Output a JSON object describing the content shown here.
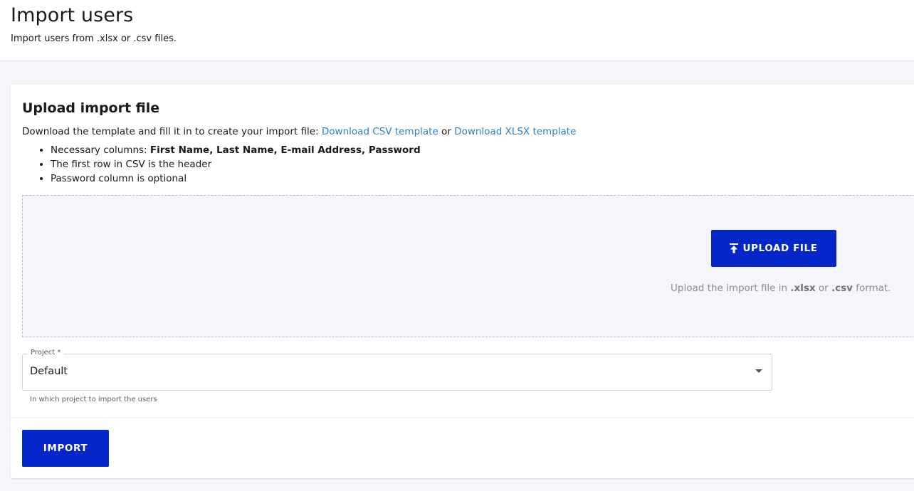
{
  "header": {
    "title": "Import users",
    "subtitle": "Import users from .xlsx or .csv files."
  },
  "card": {
    "title": "Upload import file",
    "description": "Download the template and fill it in to create your import file: ",
    "csv_link": "Download CSV template",
    "or_text": " or ",
    "xlsx_link": "Download XLSX template",
    "requirements": [
      {
        "text": "Necessary columns: ",
        "bold": "First Name, Last Name, E-mail Address, Password"
      },
      {
        "text": "The first row in CSV is the header"
      },
      {
        "text": "Password column is optional"
      }
    ]
  },
  "upload": {
    "button_label": "UPLOAD FILE",
    "icon": "upload-icon",
    "hint_prefix": "Upload the import file in ",
    "hint_xlsx": ".xlsx",
    "hint_or": " or ",
    "hint_csv": ".csv",
    "hint_suffix": " format."
  },
  "project_select": {
    "label": "Project *",
    "value": "Default",
    "helper": "In which project to import the users"
  },
  "actions": {
    "import_label": "IMPORT"
  },
  "colors": {
    "primary": "#0527c9",
    "link": "#2f7fc1",
    "background": "#f5f6fa"
  }
}
